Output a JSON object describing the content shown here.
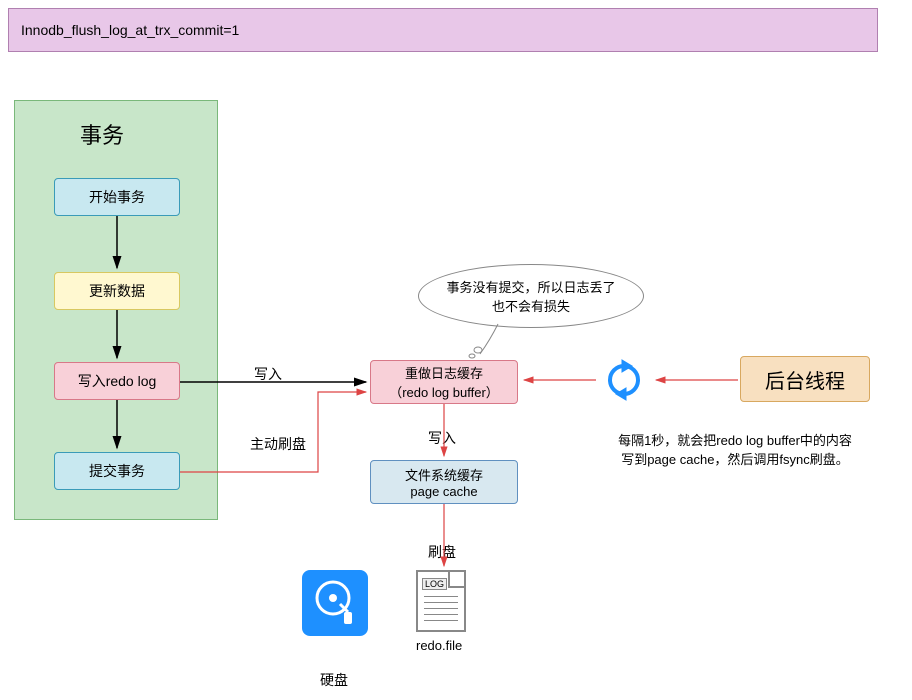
{
  "title_bar": "Innodb_flush_log_at_trx_commit=1",
  "transaction_group": {
    "title": "事务",
    "steps": {
      "start": "开始事务",
      "update": "更新数据",
      "write_redo": "写入redo log",
      "commit": "提交事务"
    }
  },
  "labels": {
    "write1": "写入",
    "active_flush": "主动刷盘",
    "write2": "写入",
    "flush": "刷盘"
  },
  "redo_buffer": {
    "line1": "重做日志缓存",
    "line2": "（redo log buffer）"
  },
  "page_cache": {
    "line1": "文件系统缓存",
    "line2": "page cache"
  },
  "bubble": {
    "line1": "事务没有提交，所以日志丢了",
    "line2": "也不会有损失"
  },
  "background_thread": "后台线程",
  "bg_description": {
    "line1": "每隔1秒，就会把redo log buffer中的内容",
    "line2": "写到page cache，然后调用fsync刷盘。"
  },
  "disk_label": "硬盘",
  "file_label": "redo.file",
  "file_tag": "LOG"
}
